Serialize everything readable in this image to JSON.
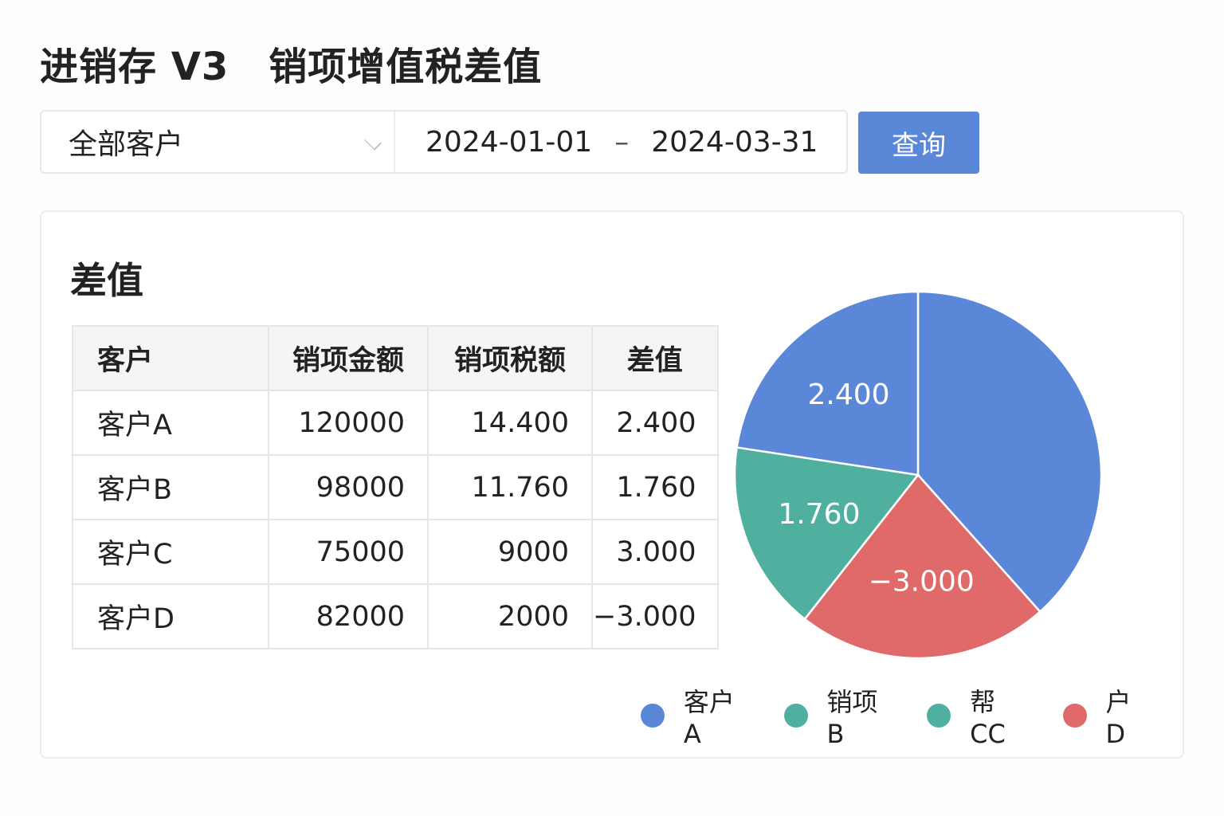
{
  "header": {
    "app": "进销存 V3",
    "title": "销项增值税差值"
  },
  "filter": {
    "customer": "全部客户",
    "date_start": "2024-01-01",
    "date_sep": "–",
    "date_end": "2024-03-31",
    "query_label": "查询"
  },
  "card_title": "差值",
  "table": {
    "headers": [
      "客户",
      "销项金额",
      "销项税额",
      "差值"
    ],
    "rows": [
      [
        "客户A",
        "120000",
        "14.400",
        "2.400"
      ],
      [
        "客户B",
        "98000",
        "11.760",
        "1.760"
      ],
      [
        "客户C",
        "75000",
        "9000",
        "3.000"
      ],
      [
        "客户D",
        "82000",
        "2000",
        "−3.000"
      ]
    ]
  },
  "chart_data": {
    "type": "pie",
    "slices": [
      {
        "label": "",
        "share": 0.384,
        "color": "#5b87d9"
      },
      {
        "label": "−3.000",
        "share": 0.222,
        "color": "#e06a6a"
      },
      {
        "label": "1.760",
        "share": 0.168,
        "color": "#4fb0a0"
      },
      {
        "label": "2.400",
        "share": 0.226,
        "color": "#5b87d9"
      }
    ],
    "legend": [
      {
        "label": "客户A",
        "color": "#5b87d9"
      },
      {
        "label": "销项B",
        "color": "#4fb0a0"
      },
      {
        "label": "帮CC",
        "color": "#4fb0a0"
      },
      {
        "label": "户D",
        "color": "#e06a6a"
      }
    ],
    "legend_position": "bottom-right"
  }
}
